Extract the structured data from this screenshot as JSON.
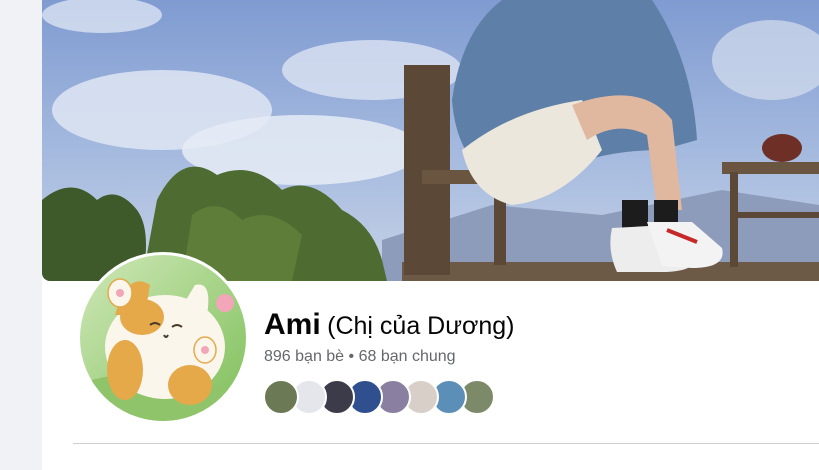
{
  "profile": {
    "name": "Ami",
    "nickname": "(Chị của Dương)",
    "friends_count": "896 bạn bè",
    "separator": "•",
    "mutual_count": "68 bạn chung"
  },
  "mutual_friends": [
    {
      "label": "mutual-friend-1",
      "color": "#6b7a55"
    },
    {
      "label": "mutual-friend-2",
      "color": "#e4e6eb"
    },
    {
      "label": "mutual-friend-3",
      "color": "#3b3b4a"
    },
    {
      "label": "mutual-friend-4",
      "color": "#2f4f8f"
    },
    {
      "label": "mutual-friend-5",
      "color": "#8a7fa0"
    },
    {
      "label": "mutual-friend-6",
      "color": "#d9cfc9"
    },
    {
      "label": "mutual-friend-7",
      "color": "#5b8fb8"
    },
    {
      "label": "mutual-friend-8",
      "color": "#7d8a6a"
    }
  ],
  "colors": {
    "sky": "#9fb4dc",
    "accent": "#1877f2",
    "text_primary": "#050505",
    "text_secondary": "#65676b"
  }
}
